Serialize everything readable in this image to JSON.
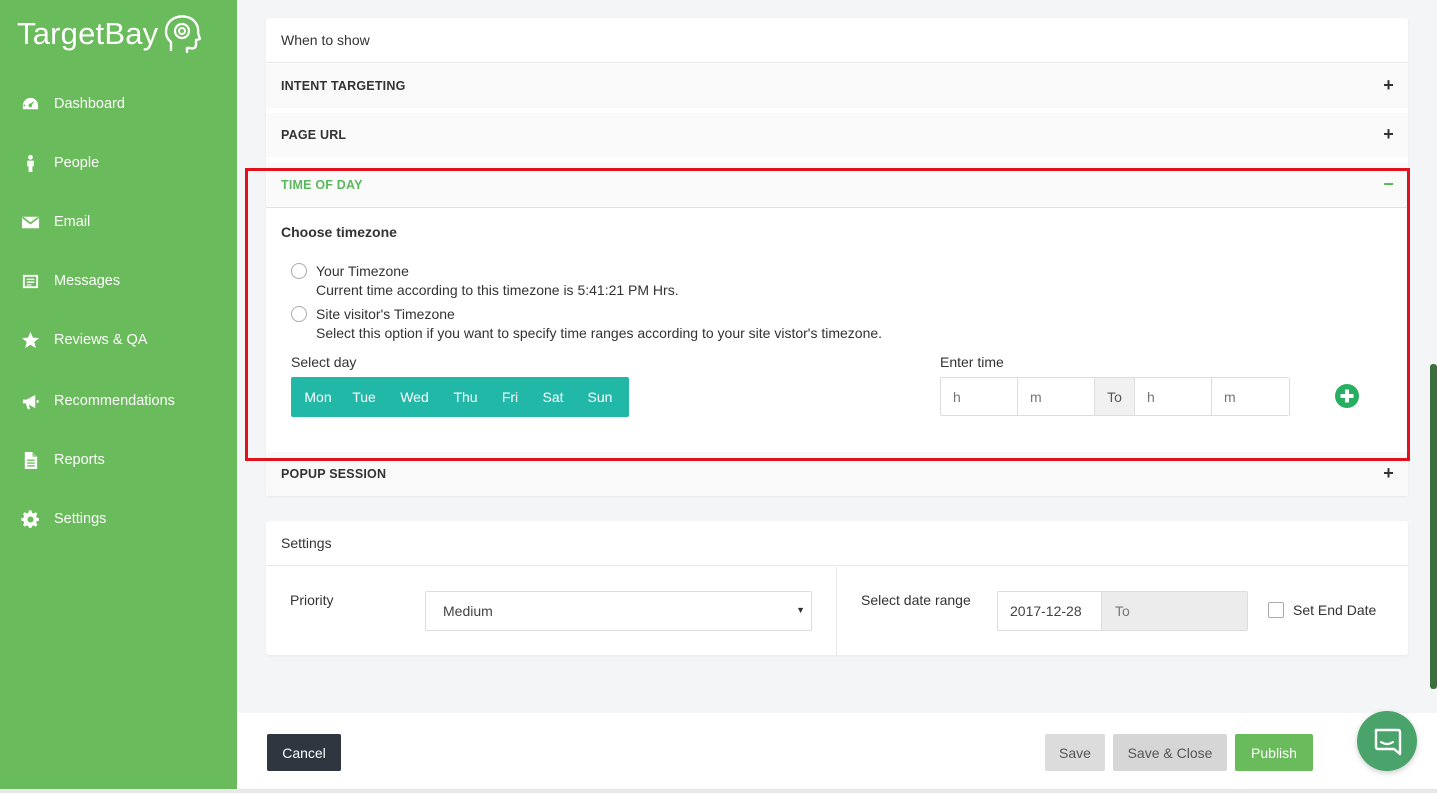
{
  "brand": {
    "name": "TargetBay"
  },
  "sidebar": {
    "items": [
      {
        "label": "Dashboard",
        "icon": "dashboard-icon"
      },
      {
        "label": "People",
        "icon": "person-icon"
      },
      {
        "label": "Email",
        "icon": "envelope-icon"
      },
      {
        "label": "Messages",
        "icon": "messages-icon"
      },
      {
        "label": "Reviews & QA",
        "icon": "star-icon"
      },
      {
        "label": "Recommendations",
        "icon": "megaphone-icon"
      },
      {
        "label": "Reports",
        "icon": "document-icon"
      },
      {
        "label": "Settings",
        "icon": "gear-icon"
      }
    ]
  },
  "when_to_show": {
    "title": "When to show",
    "sections": {
      "intent": {
        "label": "INTENT TARGETING",
        "sign": "+"
      },
      "page_url": {
        "label": "PAGE URL",
        "sign": "+"
      },
      "time_of_day": {
        "label": "TIME OF DAY",
        "sign": "−"
      },
      "popup_session": {
        "label": "POPUP SESSION",
        "sign": "+"
      }
    },
    "time_of_day": {
      "choose_timezone": "Choose timezone",
      "your_timezone": {
        "label": "Your Timezone",
        "description": "Current time according to this timezone is 5:41:21 PM Hrs."
      },
      "visitor_timezone": {
        "label": "Site visitor's Timezone",
        "description": "Select this option if you want to specify time ranges according to your site vistor's timezone."
      },
      "select_day_label": "Select day",
      "days": [
        "Mon",
        "Tue",
        "Wed",
        "Thu",
        "Fri",
        "Sat",
        "Sun"
      ],
      "enter_time_label": "Enter time",
      "time": {
        "start_h_placeholder": "h",
        "start_m_placeholder": "m",
        "to_label": "To",
        "end_h_placeholder": "h",
        "end_m_placeholder": "m"
      }
    }
  },
  "settings": {
    "title": "Settings",
    "priority_label": "Priority",
    "priority_value": "Medium",
    "date_range_label": "Select date range",
    "date_start": "2017-12-28",
    "date_end_placeholder": "To",
    "set_end_date_label": "Set End Date"
  },
  "footer": {
    "cancel": "Cancel",
    "save": "Save",
    "save_close": "Save & Close",
    "publish": "Publish"
  },
  "colors": {
    "sidebar_bg": "#6abb5b",
    "teal": "#21b8a8",
    "active_green": "#5cb85c",
    "highlight_red": "#e0121d",
    "dark_button": "#2f3640"
  }
}
